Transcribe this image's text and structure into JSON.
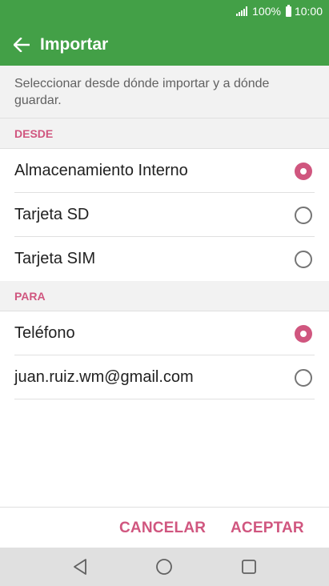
{
  "status_bar": {
    "battery": "100%",
    "time": "10:00"
  },
  "app_bar": {
    "title": "Importar"
  },
  "description": "Seleccionar desde dónde importar y a dónde guardar.",
  "desde": {
    "header": "DESDE",
    "options": [
      {
        "label": "Almacenamiento Interno",
        "checked": true
      },
      {
        "label": "Tarjeta SD",
        "checked": false
      },
      {
        "label": "Tarjeta SIM",
        "checked": false
      }
    ]
  },
  "para": {
    "header": "PARA",
    "options": [
      {
        "label": "Teléfono",
        "checked": true
      },
      {
        "label": "juan.ruiz.wm@gmail.com",
        "checked": false
      }
    ]
  },
  "footer": {
    "cancel_label": "CANCELAR",
    "accept_label": "ACEPTAR"
  },
  "colors": {
    "app_bar": "#43a047",
    "accent": "#d0567f",
    "section_bg": "#f2f2f2"
  }
}
